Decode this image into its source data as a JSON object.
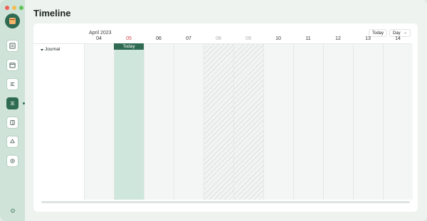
{
  "window": {
    "controls": [
      "close",
      "minimize",
      "zoom"
    ]
  },
  "sidebar": {
    "logo_icon": "calendar-app-icon",
    "items": [
      {
        "name": "sidebar-item-dashboard",
        "icon": "grid-list-icon",
        "active": false
      },
      {
        "name": "sidebar-item-calendar",
        "icon": "calendar-icon",
        "active": false
      },
      {
        "name": "sidebar-item-list",
        "icon": "list-icon",
        "active": false
      },
      {
        "name": "sidebar-item-timeline",
        "icon": "timeline-icon",
        "active": true
      },
      {
        "name": "sidebar-item-panel",
        "icon": "sidebar-panel-icon",
        "active": false
      },
      {
        "name": "sidebar-item-recycle",
        "icon": "recycle-icon",
        "active": false
      },
      {
        "name": "sidebar-item-settings",
        "icon": "gear-icon",
        "active": false
      }
    ],
    "power_icon": "power-icon"
  },
  "page": {
    "title": "Timeline"
  },
  "timeline": {
    "month": "April 2023",
    "today_button": "Today",
    "view_select": "Day",
    "today_tag": "Today",
    "days": [
      {
        "label": "04",
        "kind": "normal"
      },
      {
        "label": "05",
        "kind": "today"
      },
      {
        "label": "06",
        "kind": "normal"
      },
      {
        "label": "07",
        "kind": "normal"
      },
      {
        "label": "08",
        "kind": "weekend"
      },
      {
        "label": "09",
        "kind": "weekend"
      },
      {
        "label": "10",
        "kind": "normal"
      },
      {
        "label": "11",
        "kind": "normal"
      },
      {
        "label": "12",
        "kind": "normal"
      },
      {
        "label": "13",
        "kind": "normal"
      },
      {
        "label": "14",
        "kind": "normal"
      }
    ],
    "rows": [
      {
        "label": "Journal",
        "expanded": true
      }
    ]
  },
  "colors": {
    "accent": "#2f6b52",
    "today_column": "#cfe6dc",
    "today_date": "#d04040",
    "sidebar_bg": "#cfe3d8"
  }
}
